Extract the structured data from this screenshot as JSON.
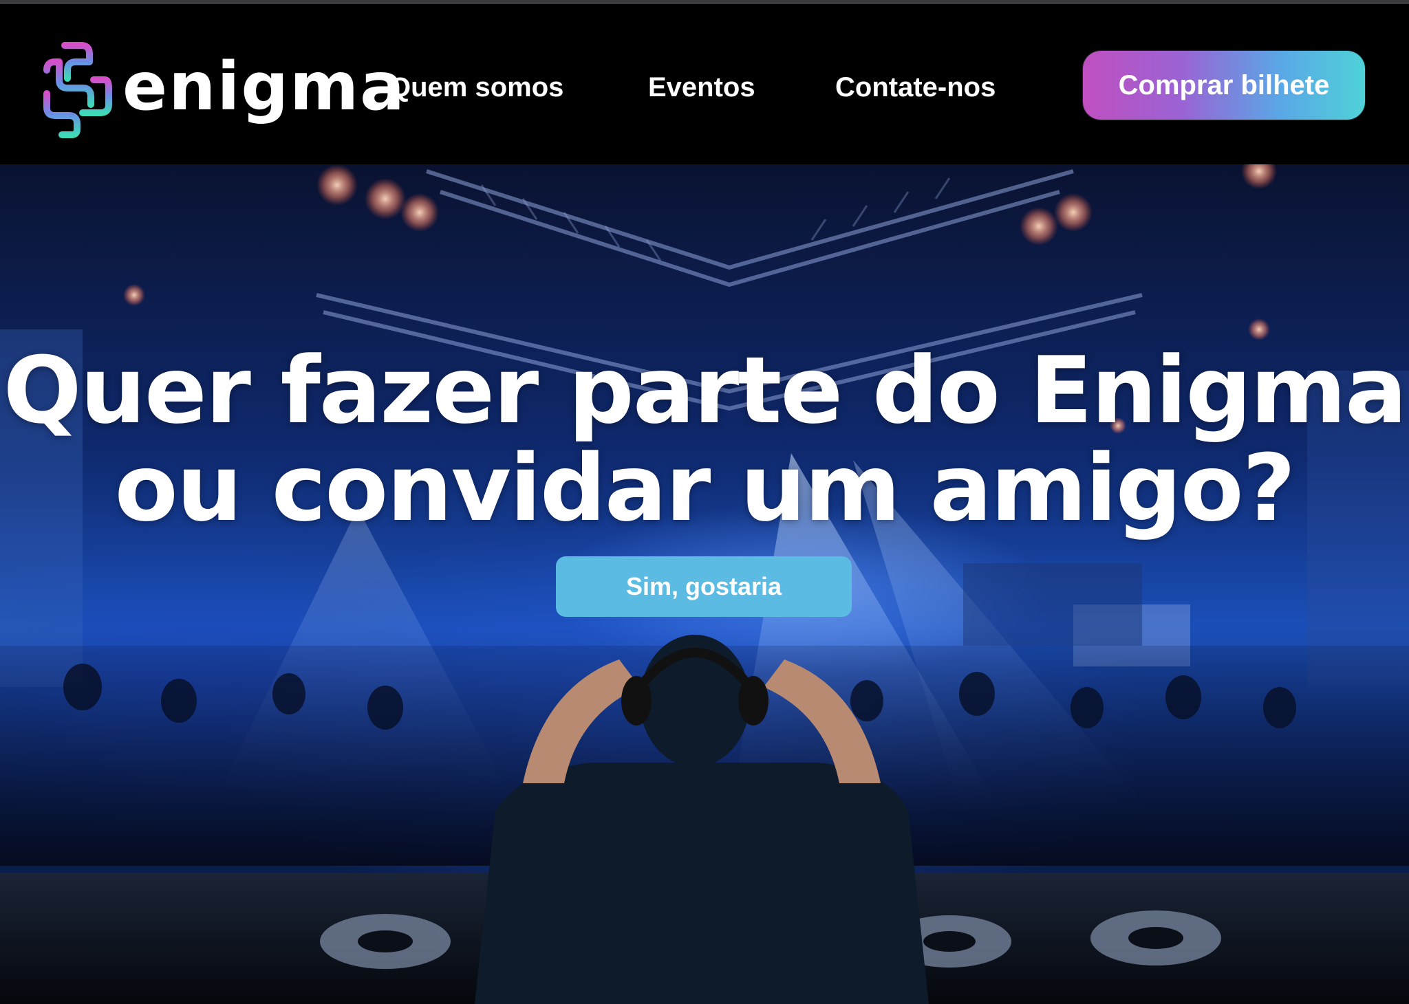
{
  "brand": {
    "name": "enigma",
    "logo_icon": "enigma-maze-logo-icon"
  },
  "nav": {
    "links": [
      {
        "label": "Quem somos"
      },
      {
        "label": "Eventos"
      },
      {
        "label": "Contate-nos"
      }
    ],
    "cta_label": "Comprar bilhete",
    "cta_gradient": [
      "#c04fc0",
      "#9a63d4",
      "#5aa7e6",
      "#4fd2d8"
    ]
  },
  "hero": {
    "headline_line1": "Quer fazer parte do Enigma",
    "headline_line2": "ou convidar um amigo?",
    "button_label": "Sim, gostaria",
    "button_color": "#5bbbe3",
    "background_scene": "dj-nightclub-photo"
  }
}
